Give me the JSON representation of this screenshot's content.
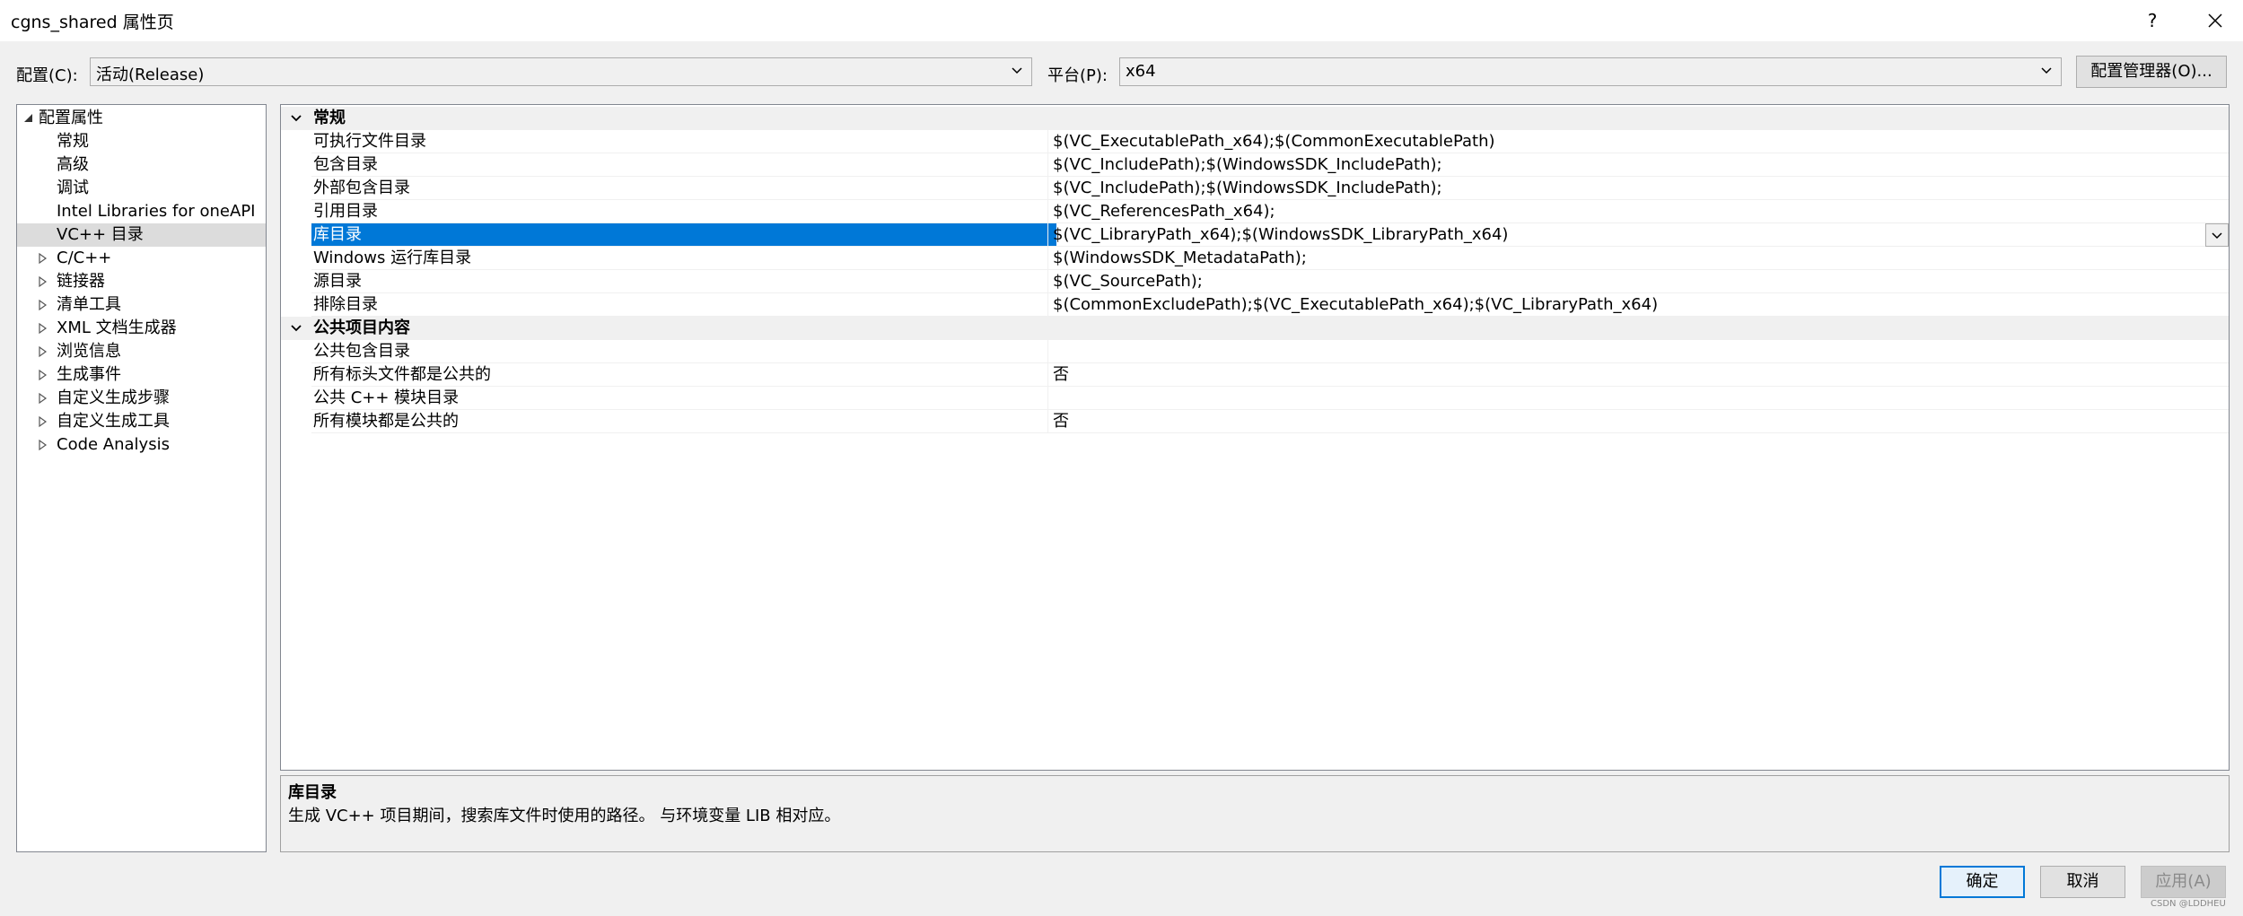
{
  "window": {
    "title": "cgns_shared 属性页",
    "help_label": "?"
  },
  "config": {
    "config_label": "配置(C):",
    "config_value": "活动(Release)",
    "platform_label": "平台(P):",
    "platform_value": "x64",
    "manager_button": "配置管理器(O)..."
  },
  "tree": {
    "root": "配置属性",
    "items": [
      {
        "label": "常规",
        "expandable": false
      },
      {
        "label": "高级",
        "expandable": false
      },
      {
        "label": "调试",
        "expandable": false
      },
      {
        "label": "Intel Libraries for oneAPI",
        "expandable": false
      },
      {
        "label": "VC++ 目录",
        "expandable": false,
        "selected": true
      },
      {
        "label": "C/C++",
        "expandable": true
      },
      {
        "label": "链接器",
        "expandable": true
      },
      {
        "label": "清单工具",
        "expandable": true
      },
      {
        "label": "XML 文档生成器",
        "expandable": true
      },
      {
        "label": "浏览信息",
        "expandable": true
      },
      {
        "label": "生成事件",
        "expandable": true
      },
      {
        "label": "自定义生成步骤",
        "expandable": true
      },
      {
        "label": "自定义生成工具",
        "expandable": true
      },
      {
        "label": "Code Analysis",
        "expandable": true
      }
    ]
  },
  "grid": {
    "categories": [
      {
        "name": "常规",
        "rows": [
          {
            "name": "可执行文件目录",
            "value": "$(VC_ExecutablePath_x64);$(CommonExecutablePath)"
          },
          {
            "name": "包含目录",
            "value": "$(VC_IncludePath);$(WindowsSDK_IncludePath);"
          },
          {
            "name": "外部包含目录",
            "value": "$(VC_IncludePath);$(WindowsSDK_IncludePath);"
          },
          {
            "name": "引用目录",
            "value": "$(VC_ReferencesPath_x64);"
          },
          {
            "name": "库目录",
            "value": "$(VC_LibraryPath_x64);$(WindowsSDK_LibraryPath_x64)",
            "selected": true
          },
          {
            "name": "Windows 运行库目录",
            "value": "$(WindowsSDK_MetadataPath);"
          },
          {
            "name": "源目录",
            "value": "$(VC_SourcePath);"
          },
          {
            "name": "排除目录",
            "value": "$(CommonExcludePath);$(VC_ExecutablePath_x64);$(VC_LibraryPath_x64)"
          }
        ]
      },
      {
        "name": "公共项目内容",
        "rows": [
          {
            "name": "公共包含目录",
            "value": ""
          },
          {
            "name": "所有标头文件都是公共的",
            "value": "否"
          },
          {
            "name": "公共 C++ 模块目录",
            "value": ""
          },
          {
            "name": "所有模块都是公共的",
            "value": "否"
          }
        ]
      }
    ]
  },
  "description": {
    "title": "库目录",
    "text": "生成 VC++ 项目期间，搜索库文件时使用的路径。 与环境变量 LIB 相对应。"
  },
  "buttons": {
    "ok": "确定",
    "cancel": "取消",
    "apply": "应用(A)"
  },
  "watermark": "CSDN @LDDHEU",
  "colors": {
    "selection": "#0078d7",
    "tree_selection": "#dcdcdc"
  }
}
